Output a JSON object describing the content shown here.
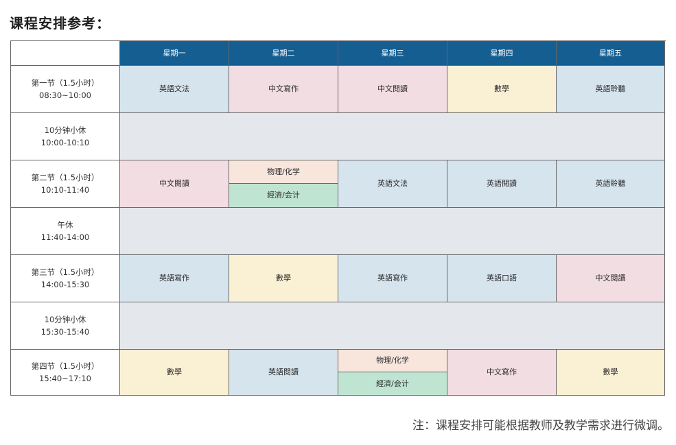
{
  "title": "课程安排参考：",
  "days": [
    "星期一",
    "星期二",
    "星期三",
    "星期四",
    "星期五"
  ],
  "rows": {
    "p1": {
      "label1": "第一节（1.5小时）",
      "label2": "08:30~10:00",
      "c1": "英語文法",
      "c2": "中文寫作",
      "c3": "中文閱讀",
      "c4": "數學",
      "c5": "英語聆聽"
    },
    "b1": {
      "label1": "10分钟小休",
      "label2": "10:00-10:10"
    },
    "p2": {
      "label1": "第二节（1.5小时）",
      "label2": "10:10-11:40",
      "c1": "中文閱讀",
      "c2a": "物理/化学",
      "c2b": "經濟/会计",
      "c3": "英語文法",
      "c4": "英語閱讀",
      "c5": "英語聆聽"
    },
    "lunch": {
      "label1": "午休",
      "label2": "11:40-14:00"
    },
    "p3": {
      "label1": "第三节（1.5小时）",
      "label2": "14:00-15:30",
      "c1": "英語寫作",
      "c2": "數學",
      "c3": "英語寫作",
      "c4": "英語口語",
      "c5": "中文閱讀"
    },
    "b2": {
      "label1": "10分钟小休",
      "label2": "15:30-15:40"
    },
    "p4": {
      "label1": "第四节（1.5小时）",
      "label2": "15:40~17:10",
      "c1": "數學",
      "c2": "英語閱讀",
      "c3a": "物理/化学",
      "c3b": "經濟/会计",
      "c4": "中文寫作",
      "c5": "數學"
    }
  },
  "note": "注：课程安排可能根据教师及教学需求进行微调。",
  "colors": {
    "header": "#155e92",
    "blue": "#d6e4ee",
    "pink": "#f2dde2",
    "yellow": "#faf0d4",
    "peach": "#f8e6dd",
    "green": "#bfe5d2",
    "gray": "#e4e8ec"
  }
}
